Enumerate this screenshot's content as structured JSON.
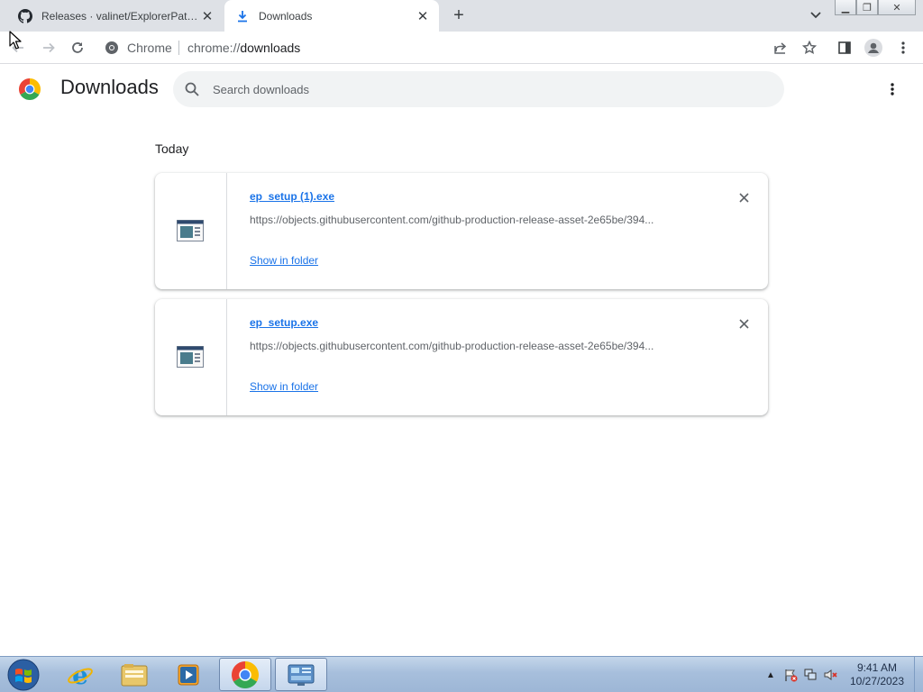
{
  "browser": {
    "tabs": [
      {
        "title": "Releases · valinet/ExplorerPatcher",
        "favicon": "github-icon",
        "active": false
      },
      {
        "title": "Downloads",
        "favicon": "download-icon",
        "active": true
      }
    ],
    "omnibox": {
      "chip_label": "Chrome",
      "url_scheme": "chrome://",
      "url_host": "downloads"
    }
  },
  "page": {
    "title": "Downloads",
    "search": {
      "placeholder": "Search downloads",
      "value": ""
    },
    "section_label": "Today",
    "items": [
      {
        "name": "ep_setup (1).exe",
        "url": "https://objects.githubusercontent.com/github-production-release-asset-2e65be/394...",
        "action": "Show in folder"
      },
      {
        "name": "ep_setup.exe",
        "url": "https://objects.githubusercontent.com/github-production-release-asset-2e65be/394...",
        "action": "Show in folder"
      }
    ]
  },
  "taskbar": {
    "items": [
      "internet-explorer",
      "windows-explorer",
      "media-player",
      "google-chrome",
      "control-panel"
    ],
    "active_item": "google-chrome",
    "clock": {
      "time": "9:41 AM",
      "date": "10/27/2023"
    }
  },
  "colors": {
    "accent": "#1a73e8",
    "tabstrip": "#dee1e6",
    "search_bg": "#f1f3f4",
    "text_secondary": "#5f6368"
  }
}
